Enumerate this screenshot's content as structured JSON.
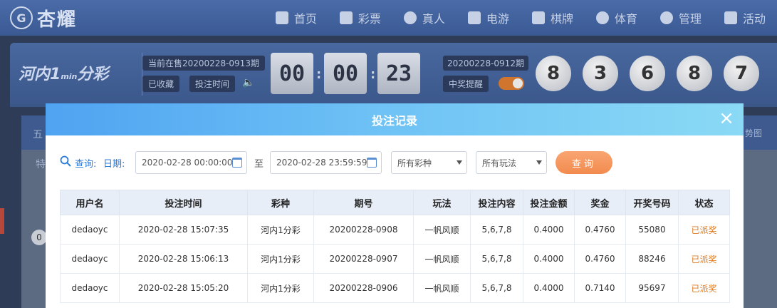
{
  "site": {
    "logo_badge": "G",
    "logo_text": "杏耀"
  },
  "nav": [
    {
      "label": "首页",
      "icon": "home-icon"
    },
    {
      "label": "彩票",
      "icon": "ticket-icon"
    },
    {
      "label": "真人",
      "icon": "person-icon"
    },
    {
      "label": "电游",
      "icon": "slot-machine-icon"
    },
    {
      "label": "棋牌",
      "icon": "cards-icon"
    },
    {
      "label": "体育",
      "icon": "trophy-icon"
    },
    {
      "label": "管理",
      "icon": "users-icon"
    },
    {
      "label": "活动",
      "icon": "gift-icon"
    }
  ],
  "lottery": {
    "logo_main": "河内1",
    "logo_sub": "分彩",
    "logo_min": "min",
    "current_period": "当前在售20200228-0913期",
    "favorited_label": "已收藏",
    "bet_time_label": "投注时间",
    "countdown": [
      "00",
      "00",
      "23"
    ],
    "previous_period": "20200228-0912期",
    "win_remind_label": "中奖提醒",
    "balls": [
      "8",
      "3",
      "6",
      "8",
      "7"
    ]
  },
  "behind": {
    "tab_text": "五",
    "row_text": "特",
    "right_text": "势图",
    "chip": "0"
  },
  "modal": {
    "title": "投注记录",
    "close_glyph": "×",
    "query_label": "查询:",
    "date_label": "日期:",
    "date_from": "2020-02-28 00:00:00",
    "to_label": "至",
    "date_to": "2020-02-28 23:59:59",
    "lottery_select": "所有彩种",
    "play_select": "所有玩法",
    "query_button": "查询"
  },
  "table": {
    "headers": [
      "用户名",
      "投注时间",
      "彩种",
      "期号",
      "玩法",
      "投注内容",
      "投注金额",
      "奖金",
      "开奖号码",
      "状态"
    ],
    "rows": [
      [
        "dedaoyc",
        "2020-02-28 15:07:35",
        "河内1分彩",
        "20200228-0908",
        "一帆风顺",
        "5,6,7,8",
        "0.4000",
        "0.4760",
        "55080",
        "已派奖"
      ],
      [
        "dedaoyc",
        "2020-02-28 15:06:13",
        "河内1分彩",
        "20200228-0907",
        "一帆风顺",
        "5,6,7,8",
        "0.4000",
        "0.4760",
        "88246",
        "已派奖"
      ],
      [
        "dedaoyc",
        "2020-02-28 15:05:20",
        "河内1分彩",
        "20200228-0906",
        "一帆风顺",
        "5,6,7,8",
        "0.4000",
        "0.7140",
        "95697",
        "已派奖"
      ]
    ]
  }
}
